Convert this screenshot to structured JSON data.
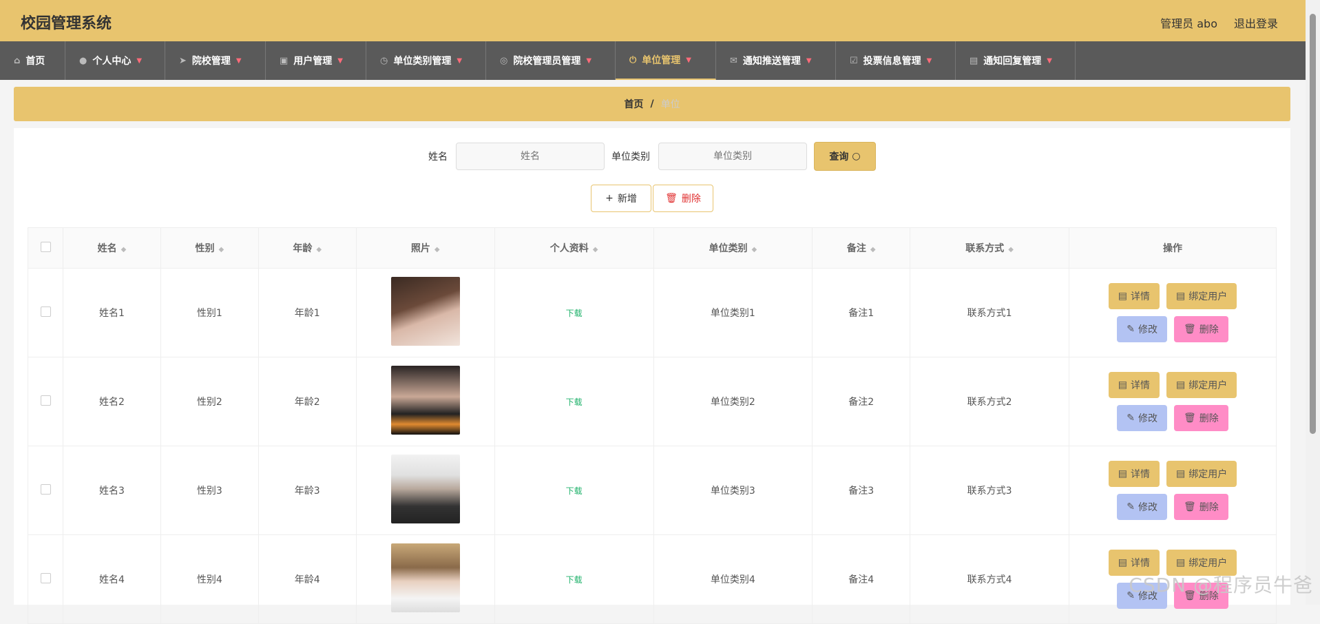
{
  "app": {
    "title": "校园管理系统",
    "user_label": "管理员 abo",
    "logout_label": "退出登录"
  },
  "nav": [
    {
      "label": "首页",
      "icon": "home-icon",
      "caret": false
    },
    {
      "label": "个人中心",
      "icon": "user-icon",
      "caret": true
    },
    {
      "label": "院校管理",
      "icon": "send-icon",
      "caret": true
    },
    {
      "label": "用户管理",
      "icon": "clipboard-icon",
      "caret": true
    },
    {
      "label": "单位类别管理",
      "icon": "clock-icon",
      "caret": true
    },
    {
      "label": "院校管理员管理",
      "icon": "compass-icon",
      "caret": true
    },
    {
      "label": "单位管理",
      "icon": "power-icon",
      "caret": true,
      "active": true
    },
    {
      "label": "通知推送管理",
      "icon": "chat-icon",
      "caret": true
    },
    {
      "label": "投票信息管理",
      "icon": "check-icon",
      "caret": true
    },
    {
      "label": "通知回复管理",
      "icon": "document-icon",
      "caret": true
    }
  ],
  "breadcrumb": {
    "home": "首页",
    "separator": "/",
    "current": "单位"
  },
  "search": {
    "name_label": "姓名",
    "name_placeholder": "姓名",
    "type_label": "单位类别",
    "type_placeholder": "单位类别",
    "query_label": "查询"
  },
  "actions": {
    "add_label": "新增",
    "delete_label": "删除"
  },
  "table": {
    "headers": [
      "姓名",
      "性别",
      "年龄",
      "照片",
      "个人资料",
      "单位类别",
      "备注",
      "联系方式",
      "操作"
    ],
    "rows": [
      {
        "name": "姓名1",
        "gender": "性别1",
        "age": "年龄1",
        "profile": "下载",
        "type": "单位类别1",
        "note": "备注1",
        "contact": "联系方式1"
      },
      {
        "name": "姓名2",
        "gender": "性别2",
        "age": "年龄2",
        "profile": "下载",
        "type": "单位类别2",
        "note": "备注2",
        "contact": "联系方式2"
      },
      {
        "name": "姓名3",
        "gender": "性别3",
        "age": "年龄3",
        "profile": "下载",
        "type": "单位类别3",
        "note": "备注3",
        "contact": "联系方式3"
      },
      {
        "name": "姓名4",
        "gender": "性别4",
        "age": "年龄4",
        "profile": "下载",
        "type": "单位类别4",
        "note": "备注4",
        "contact": "联系方式4"
      }
    ],
    "op_labels": {
      "detail": "详情",
      "bind": "绑定用户",
      "edit": "修改",
      "remove": "删除"
    }
  },
  "watermark": "CSDN @程序员牛爸",
  "colors": {
    "accent": "#e8c46e",
    "nav_bg": "#5a5a5a",
    "edit": "#b3c3f3",
    "remove": "#ff8cc6",
    "download": "#20b26b"
  }
}
